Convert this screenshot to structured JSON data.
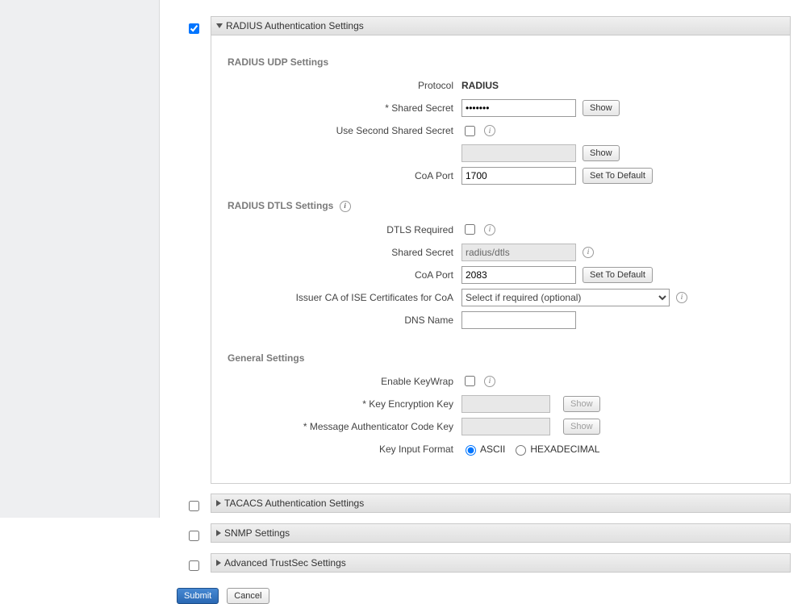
{
  "panels": {
    "radius": {
      "enabled": true,
      "title": "RADIUS Authentication Settings"
    },
    "tacacs": {
      "enabled": false,
      "title": "TACACS Authentication Settings"
    },
    "snmp": {
      "enabled": false,
      "title": "SNMP Settings"
    },
    "trustsec": {
      "enabled": false,
      "title": "Advanced TrustSec Settings"
    }
  },
  "udp": {
    "section_title": "RADIUS UDP Settings",
    "protocol_label": "Protocol",
    "protocol_value": "RADIUS",
    "shared_secret_label": "* Shared Secret",
    "shared_secret_value": "•••••••",
    "show_btn": "Show",
    "use_second_label": "Use Second Shared Secret",
    "use_second_checked": false,
    "second_show_btn": "Show",
    "coa_port_label": "CoA Port",
    "coa_port_value": "1700",
    "set_default_btn": "Set To Default"
  },
  "dtls": {
    "section_title": "RADIUS DTLS Settings",
    "required_label": "DTLS Required",
    "required_checked": false,
    "shared_secret_label": "Shared Secret",
    "shared_secret_value": "radius/dtls",
    "coa_port_label": "CoA Port",
    "coa_port_value": "2083",
    "set_default_btn": "Set To Default",
    "issuer_label": "Issuer CA of ISE Certificates for CoA",
    "issuer_value": "Select if required (optional)",
    "dns_label": "DNS Name",
    "dns_value": ""
  },
  "general": {
    "section_title": "General Settings",
    "keywrap_label": "Enable KeyWrap",
    "keywrap_checked": false,
    "kek_label": "*  Key Encryption Key",
    "kek_show_btn": "Show",
    "mack_label": "*  Message Authenticator Code Key",
    "mack_show_btn": "Show",
    "format_label": "Key Input Format",
    "format_ascii": "ASCII",
    "format_hex": "HEXADECIMAL",
    "format_selected": "ascii"
  },
  "actions": {
    "submit": "Submit",
    "cancel": "Cancel"
  }
}
